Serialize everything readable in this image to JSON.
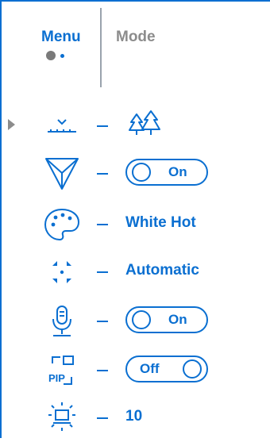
{
  "tabs": {
    "menu_label": "Menu",
    "mode_label": "Mode"
  },
  "rows": [
    {
      "icon": "calibration-horizon-icon",
      "value_icon": "forest-trees-icon"
    },
    {
      "icon": "color-filter-triangle-icon",
      "toggle": {
        "label": "On",
        "state": "on"
      }
    },
    {
      "icon": "palette-icon",
      "value": "White Hot"
    },
    {
      "icon": "calibration-arrows-icon",
      "value": "Automatic"
    },
    {
      "icon": "microphone-icon",
      "toggle": {
        "label": "On",
        "state": "on"
      }
    },
    {
      "icon": "pip-icon",
      "toggle": {
        "label": "Off",
        "state": "off"
      },
      "icon_text": "PIP"
    },
    {
      "icon": "display-brightness-icon",
      "value": "10"
    }
  ],
  "colors": {
    "accent": "#0a6fd1",
    "muted": "#8c8c8c"
  }
}
